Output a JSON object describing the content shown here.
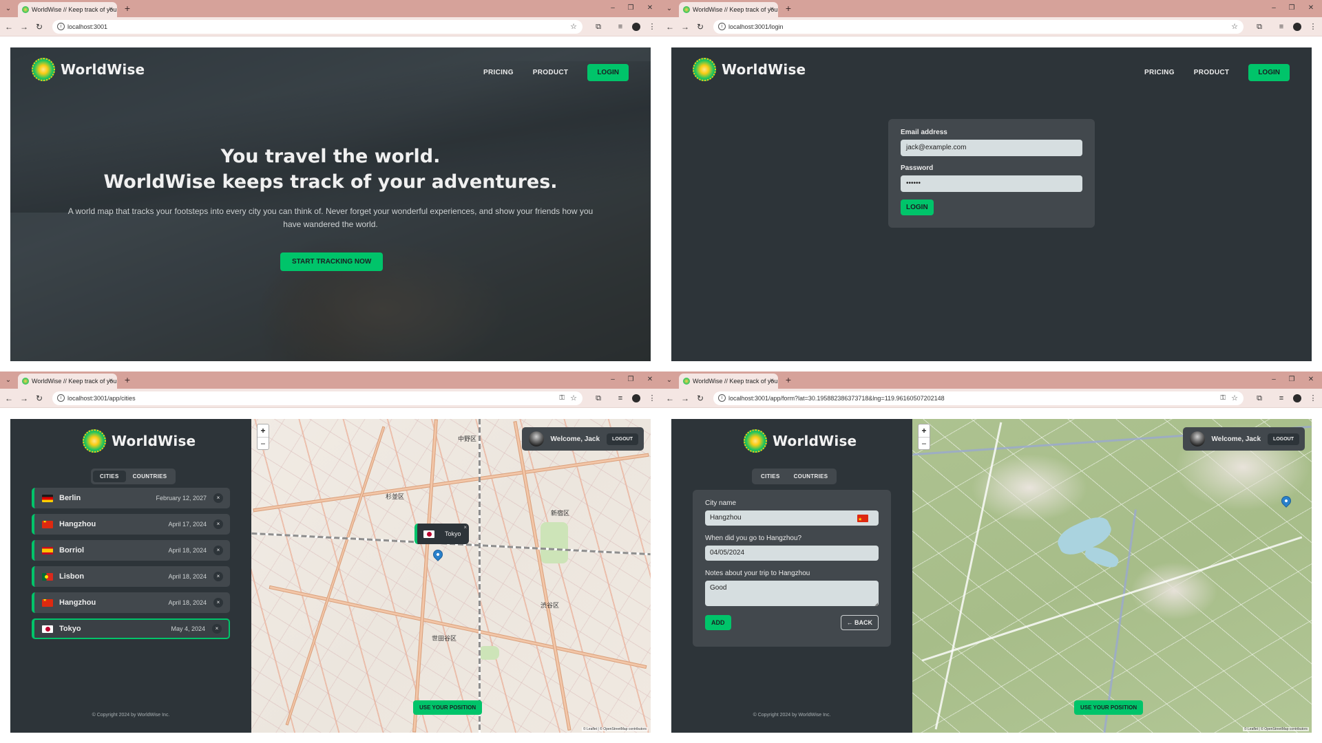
{
  "browser": {
    "tab_title": "WorldWise // Keep track of you...",
    "tab_close": "×",
    "new_tab": "+",
    "url_home": "localhost:3001",
    "url_login": "localhost:3001/login",
    "url_cities": "localhost:3001/app/cities",
    "url_form": "localhost:3001/app/form?lat=30.195882386373718&lng=119.96160507202148"
  },
  "brand": {
    "name": "WorldWise"
  },
  "nav": {
    "pricing": "PRICING",
    "product": "PRODUCT",
    "login": "LOGIN"
  },
  "home": {
    "title_line1": "You travel the world.",
    "title_line2": "WorldWise keeps track of your adventures.",
    "subtitle": "A world map that tracks your footsteps into every city you can think of. Never forget your wonderful experiences, and show your friends how you have wandered the world.",
    "cta": "START TRACKING NOW"
  },
  "login": {
    "email_label": "Email address",
    "email_value": "jack@example.com",
    "password_label": "Password",
    "password_value": "••••••",
    "submit": "LOGIN"
  },
  "app": {
    "tabs": [
      "CITIES",
      "COUNTRIES"
    ],
    "cities": [
      {
        "name": "Berlin",
        "date": "February 12, 2027",
        "flag": "de"
      },
      {
        "name": "Hangzhou",
        "date": "April 17, 2024",
        "flag": "cn"
      },
      {
        "name": "Borriol",
        "date": "April 18, 2024",
        "flag": "es"
      },
      {
        "name": "Lisbon",
        "date": "April 18, 2024",
        "flag": "pt"
      },
      {
        "name": "Hangzhou",
        "date": "April 18, 2024",
        "flag": "cn"
      },
      {
        "name": "Tokyo",
        "date": "May 4, 2024",
        "flag": "jp"
      }
    ],
    "delete_symbol": "×",
    "copyright": "© Copyright 2024 by WorldWise Inc.",
    "user": {
      "welcome": "Welcome, Jack",
      "logout": "LOGOUT"
    },
    "use_position": "USE YOUR POSITION",
    "zoom_in": "+",
    "zoom_out": "−",
    "attribution": "© Leaflet | © OpenStreetMap contributors",
    "popup_city": "Tokyo",
    "map_labels": [
      "中野区",
      "杉並区",
      "新宿区",
      "渋谷区",
      "世田谷区"
    ]
  },
  "form": {
    "city_label": "City name",
    "city_value": "Hangzhou",
    "date_label": "When did you go to Hangzhou?",
    "date_value": "04/05/2024",
    "notes_label": "Notes about your trip to Hangzhou",
    "notes_value": "Good",
    "add": "ADD",
    "back": "← BACK"
  },
  "colors": {
    "accent": "#00c46a",
    "dark": "#2d3439",
    "panel": "#42484d",
    "chrome": "#d6a29a"
  }
}
